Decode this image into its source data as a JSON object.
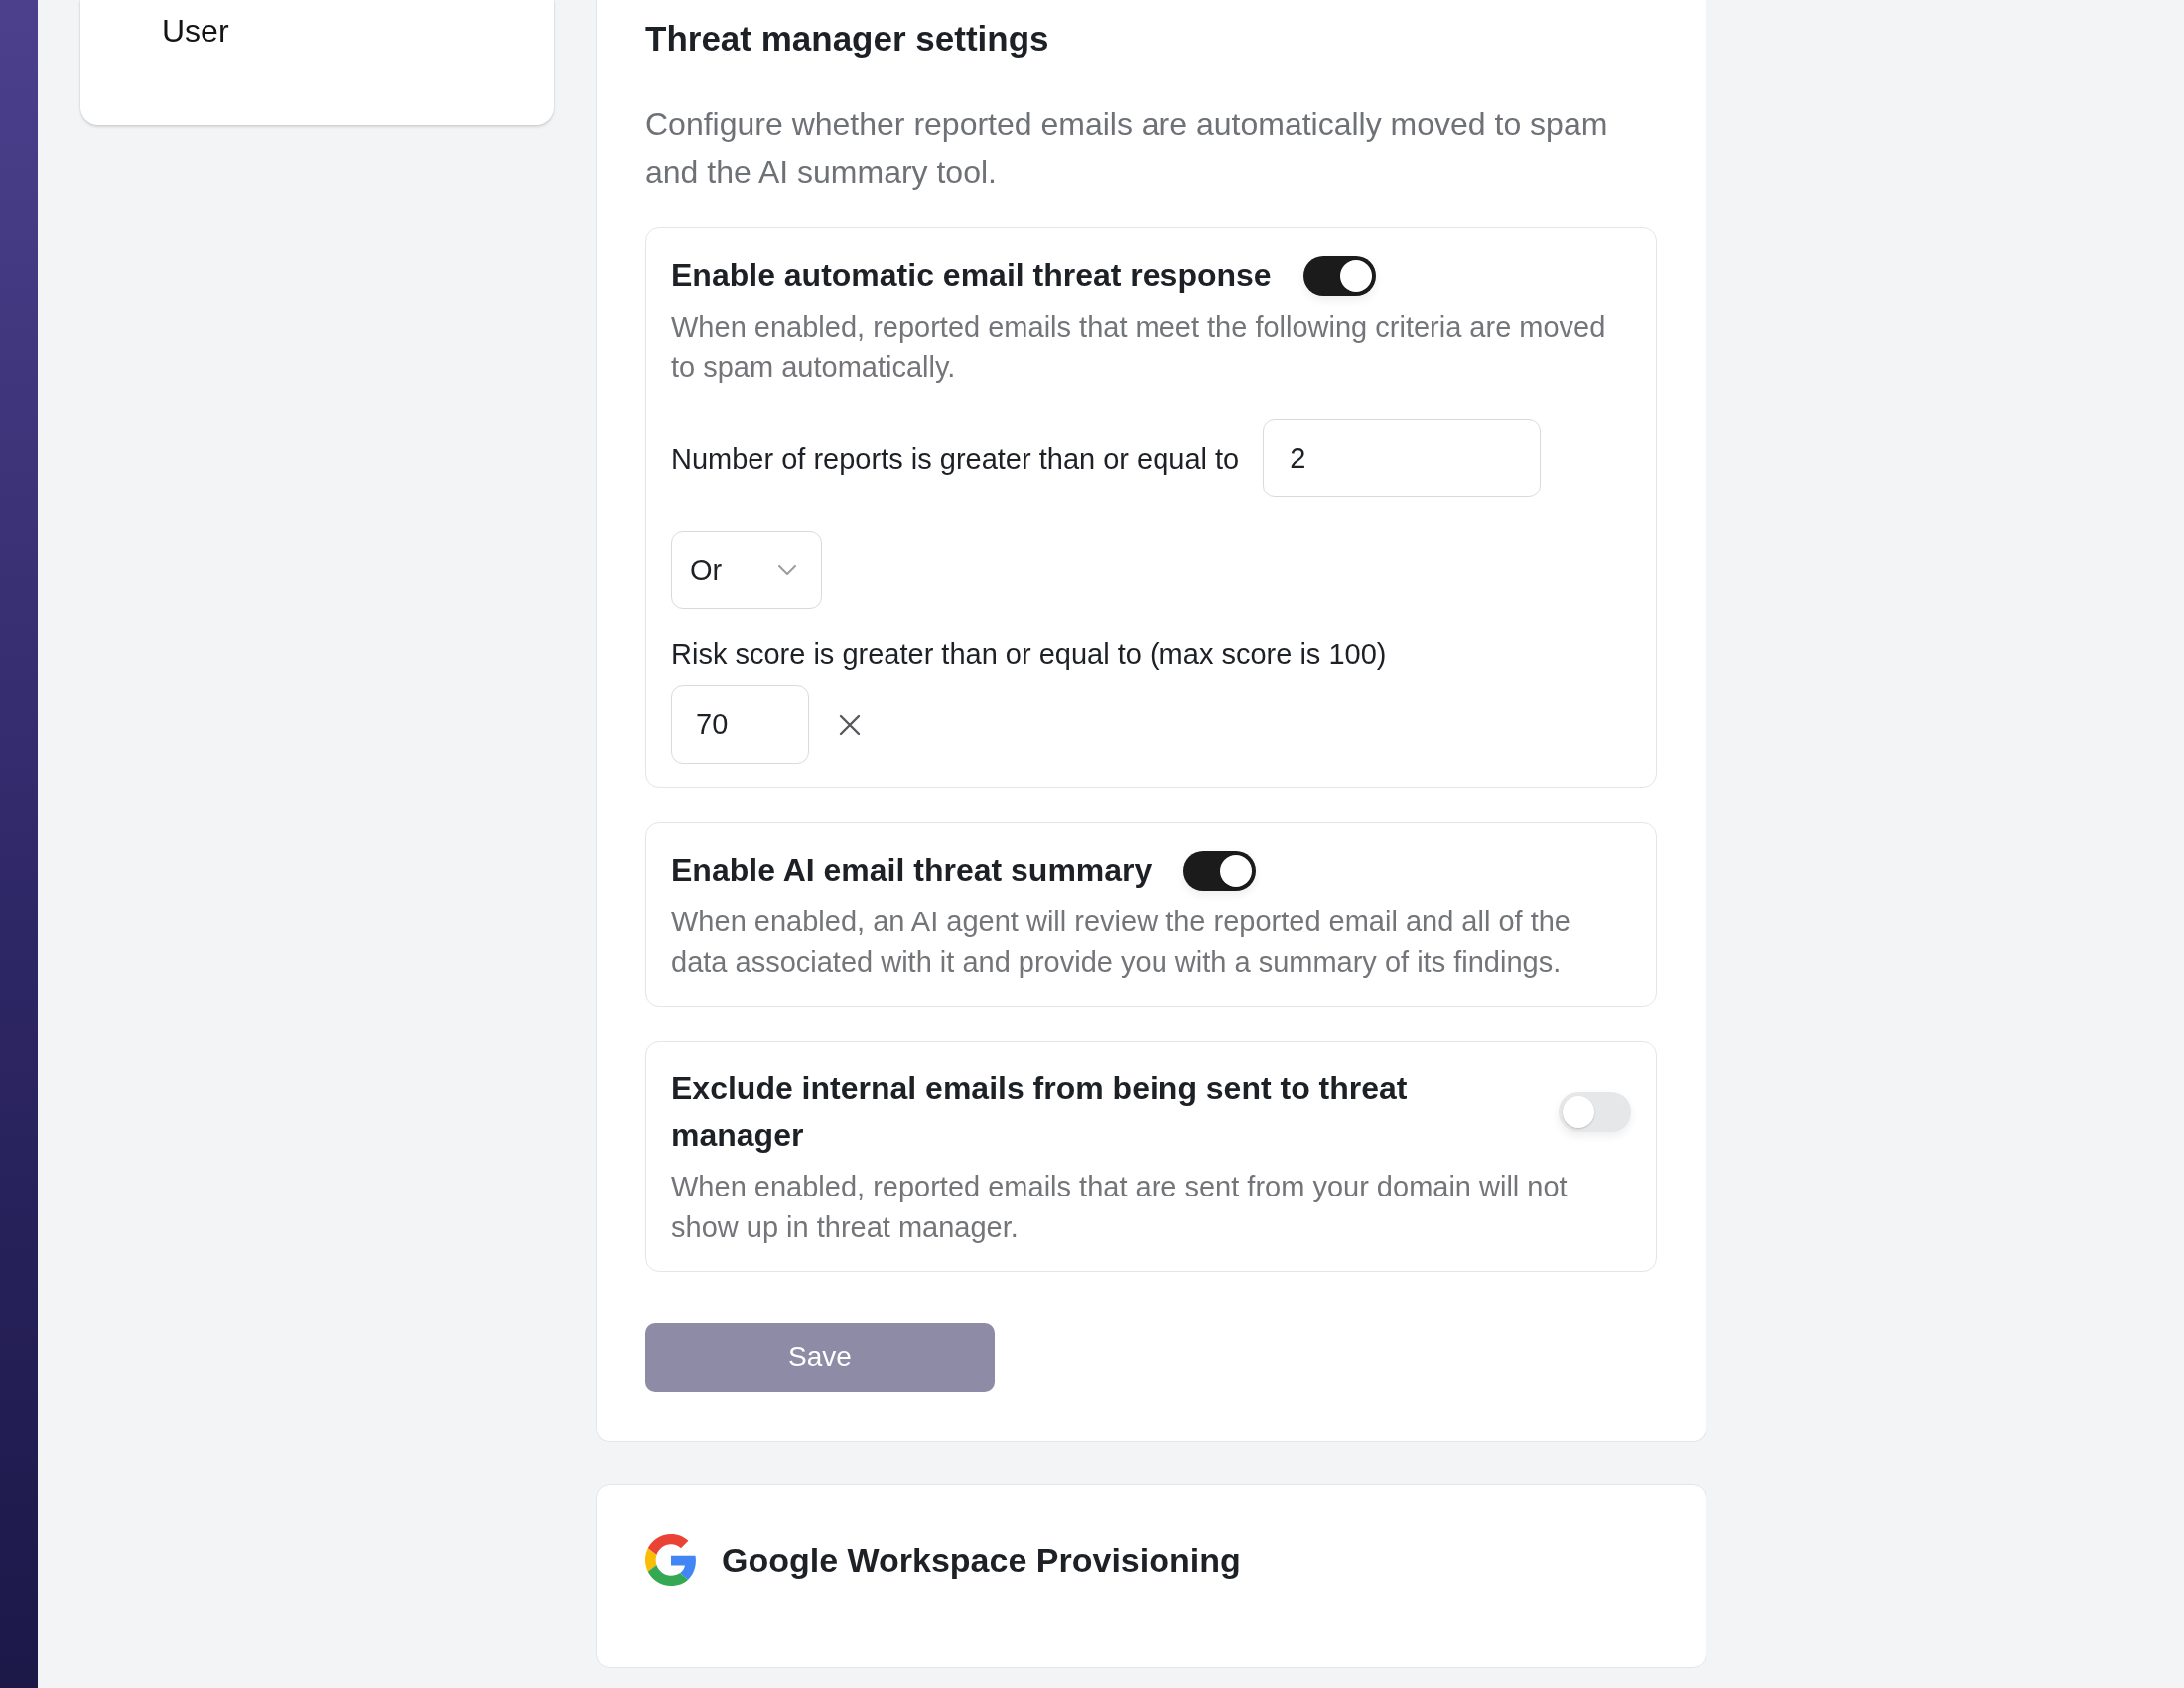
{
  "sidebar": {
    "items": [
      {
        "label": "User"
      }
    ]
  },
  "threat_manager": {
    "title": "Threat manager settings",
    "description": "Configure whether reported emails are automatically moved to spam and the AI summary tool.",
    "settings": [
      {
        "kind": "criteria",
        "title": "Enable automatic email threat response",
        "on": true,
        "description": "When enabled, reported emails that meet the following criteria are moved to spam automatically.",
        "report_count": {
          "label": "Number of reports is greater than or equal to",
          "value": "2"
        },
        "operator": {
          "value": "Or"
        },
        "risk_score": {
          "label": "Risk score is greater than or equal to (max score is 100)",
          "value": "70"
        }
      },
      {
        "kind": "toggle",
        "title": "Enable AI email threat summary",
        "on": true,
        "description": "When enabled, an AI agent will review the reported email and all of the data associated with it and provide you with a summary of its findings."
      },
      {
        "kind": "toggle",
        "title": "Exclude internal emails from being sent to threat manager",
        "on": false,
        "description": "When enabled, reported emails that are sent from your domain will not show up in threat manager."
      }
    ],
    "save_button": {
      "label": "Save",
      "disabled": true
    }
  },
  "google_workspace": {
    "title": "Google Workspace Provisioning"
  }
}
